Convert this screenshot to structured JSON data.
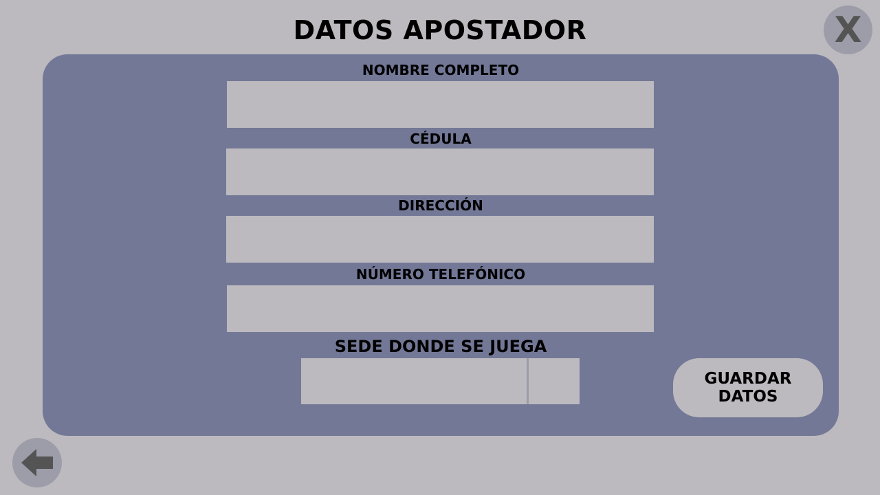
{
  "title": "DATOS APOSTADOR",
  "close_button": {
    "label": "X"
  },
  "form": {
    "full_name": {
      "label": "NOMBRE COMPLETO",
      "value": "",
      "placeholder": ""
    },
    "id_number": {
      "label": "CÉDULA",
      "value": "",
      "placeholder": ""
    },
    "address": {
      "label": "DIRECCIÓN",
      "value": "",
      "placeholder": ""
    },
    "phone": {
      "label": "NÚMERO TELEFÓNICO",
      "value": "",
      "placeholder": ""
    },
    "venue": {
      "label": "SEDE DONDE SE JUEGA",
      "selected": ""
    }
  },
  "save_button": {
    "label": "GUARDAR DATOS"
  },
  "back_button": {
    "icon": "arrow-left-icon"
  },
  "colors": {
    "background": "#bcbabe",
    "panel": "#737897",
    "input": "#bcbabe",
    "round_button": "#9c9da9",
    "icon": "#545454"
  }
}
